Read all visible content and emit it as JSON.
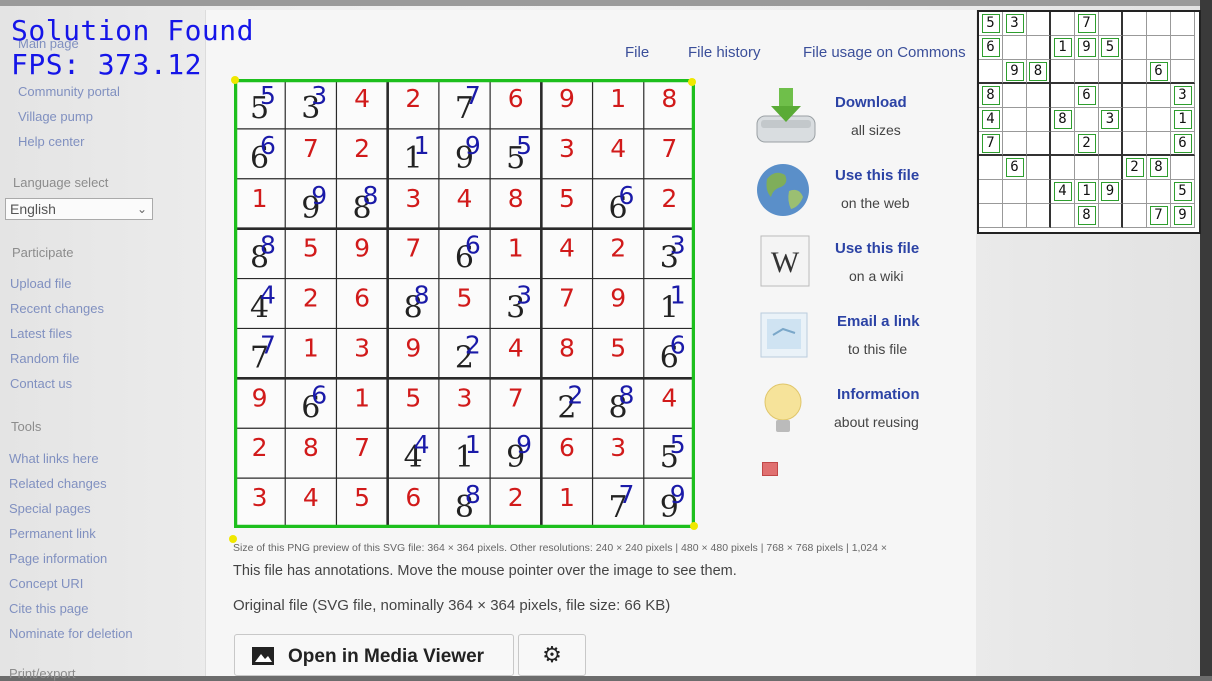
{
  "overlay": {
    "status": "Solution Found",
    "fps": "FPS: 373.12"
  },
  "sidebar": {
    "top_items": [
      "Main page",
      "Community portal",
      "Village pump",
      "Help center"
    ],
    "language_heading": "Language select",
    "language_value": "English",
    "participate_heading": "Participate",
    "participate_items": [
      "Upload file",
      "Recent changes",
      "Latest files",
      "Random file",
      "Contact us"
    ],
    "tools_heading": "Tools",
    "tools_items": [
      "What links here",
      "Related changes",
      "Special pages",
      "Permanent link",
      "Page information",
      "Concept URI",
      "Cite this page",
      "Nominate for deletion"
    ],
    "bottom_heading": "Print/export"
  },
  "tabs": [
    "File",
    "File history",
    "File usage on Commons"
  ],
  "actions": [
    {
      "title": "Download",
      "sub": "all sizes",
      "icon": "download-icon"
    },
    {
      "title": "Use this file",
      "sub": "on the web",
      "icon": "globe-icon"
    },
    {
      "title": "Use this file",
      "sub": "on a wiki",
      "icon": "wikipedia-icon"
    },
    {
      "title": "Email a link",
      "sub": "to this file",
      "icon": "email-icon"
    },
    {
      "title": "Information",
      "sub": "about reusing",
      "icon": "lightbulb-icon"
    }
  ],
  "sudoku": {
    "given": [
      [
        5,
        3,
        0,
        0,
        7,
        0,
        0,
        0,
        0
      ],
      [
        6,
        0,
        0,
        1,
        9,
        5,
        0,
        0,
        0
      ],
      [
        0,
        9,
        8,
        0,
        0,
        0,
        0,
        6,
        0
      ],
      [
        8,
        0,
        0,
        0,
        6,
        0,
        0,
        0,
        3
      ],
      [
        4,
        0,
        0,
        8,
        0,
        3,
        0,
        0,
        1
      ],
      [
        7,
        0,
        0,
        0,
        2,
        0,
        0,
        0,
        6
      ],
      [
        0,
        6,
        0,
        0,
        0,
        0,
        2,
        8,
        0
      ],
      [
        0,
        0,
        0,
        4,
        1,
        9,
        0,
        0,
        5
      ],
      [
        0,
        0,
        0,
        0,
        8,
        0,
        0,
        7,
        9
      ]
    ],
    "solution": [
      [
        5,
        3,
        4,
        2,
        7,
        6,
        9,
        1,
        8
      ],
      [
        6,
        7,
        2,
        1,
        9,
        5,
        3,
        4,
        7
      ],
      [
        1,
        9,
        8,
        3,
        4,
        8,
        5,
        6,
        2
      ],
      [
        8,
        5,
        9,
        7,
        6,
        1,
        4,
        2,
        3
      ],
      [
        4,
        2,
        6,
        8,
        5,
        3,
        7,
        9,
        1
      ],
      [
        7,
        1,
        3,
        9,
        2,
        4,
        8,
        5,
        6
      ],
      [
        9,
        6,
        1,
        5,
        3,
        7,
        2,
        8,
        4
      ],
      [
        2,
        8,
        7,
        4,
        1,
        9,
        6,
        3,
        5
      ],
      [
        3,
        4,
        5,
        6,
        8,
        2,
        1,
        7,
        9
      ]
    ],
    "colors": {
      "given": "#1a1aa8",
      "solved": "#d11a1a",
      "printed": "#222222",
      "border": "#1dbf1d",
      "corner": "#f0e800"
    }
  },
  "mini_grid": [
    [
      5,
      3,
      0,
      0,
      7,
      0,
      0,
      0,
      0
    ],
    [
      6,
      0,
      0,
      1,
      9,
      5,
      0,
      0,
      0
    ],
    [
      0,
      9,
      8,
      0,
      0,
      0,
      0,
      6,
      0
    ],
    [
      8,
      0,
      0,
      0,
      6,
      0,
      0,
      0,
      3
    ],
    [
      4,
      0,
      0,
      8,
      0,
      3,
      0,
      0,
      1
    ],
    [
      7,
      0,
      0,
      0,
      2,
      0,
      0,
      0,
      6
    ],
    [
      0,
      6,
      0,
      0,
      0,
      0,
      2,
      8,
      0
    ],
    [
      0,
      0,
      0,
      4,
      1,
      9,
      0,
      0,
      5
    ],
    [
      0,
      0,
      0,
      0,
      8,
      0,
      0,
      7,
      9
    ]
  ],
  "file_info": {
    "size_line": "Size of this PNG preview of this SVG file: 364 × 364 pixels. Other resolutions: 240 × 240 pixels | 480 × 480 pixels | 768 × 768 pixels | 1,024 ×",
    "annotations": "This file has annotations. Move the mouse pointer over the image to see them.",
    "original": "Original file (SVG file, nominally 364 × 364 pixels, file size: 66 KB)"
  },
  "buttons": {
    "media_viewer": "Open in Media Viewer",
    "media_icon": "image-icon",
    "settings_icon": "gear-icon"
  }
}
